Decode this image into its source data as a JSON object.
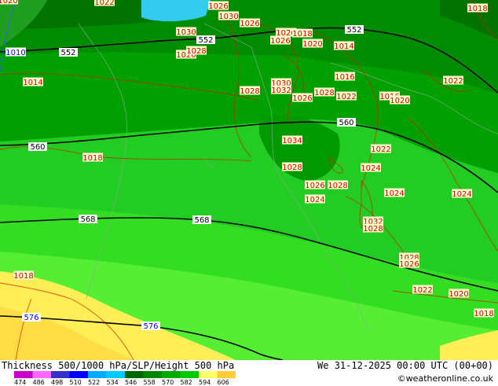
{
  "map": {
    "title": "Thickness 500/1000 hPa/SLP/Height 500 hPa",
    "datetime": "We 31-12-2025 00:00 UTC (00+00)",
    "credit": "©weatheronline.co.uk",
    "legend": {
      "ticks": [
        "474",
        "486",
        "498",
        "510",
        "522",
        "534",
        "546",
        "558",
        "570",
        "582",
        "594",
        "606"
      ],
      "colors": [
        "#cc00cc",
        "#ff66ff",
        "#3333cc",
        "#0000ff",
        "#00aaff",
        "#00ccff",
        "#006600",
        "#008800",
        "#00aa00",
        "#00cc00",
        "#ffff66",
        "#ffcc33"
      ]
    },
    "height_labels": [
      {
        "text": "552",
        "name": "height-label-552-west"
      },
      {
        "text": "552",
        "name": "height-label-552-center"
      },
      {
        "text": "552",
        "name": "height-label-552-east"
      },
      {
        "text": "560",
        "name": "height-label-560-west"
      },
      {
        "text": "560",
        "name": "height-label-560-east"
      },
      {
        "text": "568",
        "name": "height-label-568-west"
      },
      {
        "text": "568",
        "name": "height-label-568-center"
      },
      {
        "text": "576",
        "name": "height-label-576-west"
      },
      {
        "text": "576",
        "name": "height-label-576-center"
      }
    ],
    "slp_labels": [
      "1022",
      "1026",
      "1030",
      "1026",
      "1018",
      "1030",
      "1020",
      "1028",
      "1026",
      "1020",
      "1026",
      "1018",
      "1020",
      "1014",
      "1010",
      "1014",
      "1030",
      "1032",
      "1028",
      "1026",
      "1028",
      "1022",
      "1016",
      "1016",
      "1020",
      "1022",
      "1018",
      "1034",
      "1022",
      "1028",
      "1024",
      "1026",
      "1028",
      "1024",
      "1024",
      "1024",
      "1032",
      "1028",
      "1028",
      "1026",
      "1022",
      "1020",
      "1018",
      "1018",
      "1018"
    ],
    "colors": {
      "contour_height": "#000000",
      "contour_slp": "#cc2200",
      "label_slp_bg": "#ffffcc",
      "label_slp_text": "#cc0000",
      "label_height_bg": "#ffffff",
      "label_blue_text": "#0000cc"
    }
  }
}
